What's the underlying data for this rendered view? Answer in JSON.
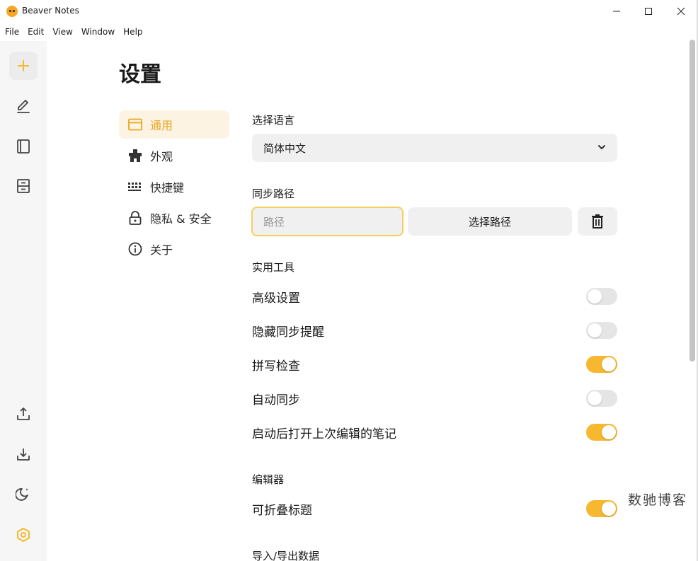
{
  "window": {
    "title": "Beaver Notes"
  },
  "menu": [
    "File",
    "Edit",
    "View",
    "Window",
    "Help"
  ],
  "iconbar": {
    "top": [
      "add-note-icon",
      "edit-icon",
      "notebook-icon",
      "archive-icon"
    ],
    "bottom": [
      "export-icon",
      "import-icon",
      "dark-mode-icon",
      "settings-icon"
    ],
    "accent": "#f5b82e"
  },
  "page": {
    "title": "设置"
  },
  "nav": [
    {
      "label": "通用",
      "icon": "general-icon",
      "active": true
    },
    {
      "label": "外观",
      "icon": "appearance-icon",
      "active": false
    },
    {
      "label": "快捷键",
      "icon": "keyboard-icon",
      "active": false
    },
    {
      "label": "隐私 & 安全",
      "icon": "lock-icon",
      "active": false
    },
    {
      "label": "关于",
      "icon": "info-icon",
      "active": false
    }
  ],
  "general": {
    "language_label": "选择语言",
    "language_value": "简体中文",
    "sync_label": "同步路径",
    "sync_placeholder": "路径",
    "choose_path": "选择路径",
    "utilities_label": "实用工具",
    "toggles": [
      {
        "label": "高级设置",
        "on": false
      },
      {
        "label": "隐藏同步提醒",
        "on": false
      },
      {
        "label": "拼写检查",
        "on": true
      },
      {
        "label": "自动同步",
        "on": false
      },
      {
        "label": "启动后打开上次编辑的笔记",
        "on": true
      }
    ],
    "editor_label": "编辑器",
    "editor_toggles": [
      {
        "label": "可折叠标题",
        "on": true
      }
    ],
    "import_export_label": "导入/导出数据"
  },
  "watermark": "数驰博客"
}
